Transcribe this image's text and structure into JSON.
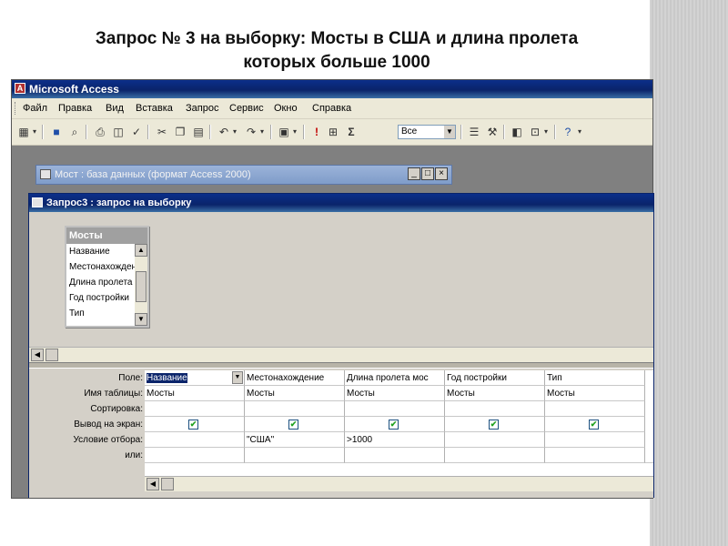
{
  "slide": {
    "title_line1": "Запрос № 3 на выборку: Мосты в США и длина пролета",
    "title_line2": "которых больше 1000"
  },
  "app": {
    "title": "Microsoft Access",
    "menu": [
      "Файл",
      "Правка",
      "Вид",
      "Вставка",
      "Запрос",
      "Сервис",
      "Окно",
      "Справка"
    ],
    "toolbar": {
      "query_type_icon": "Σ",
      "top_values": "Все"
    }
  },
  "db_window": {
    "title": "Мост : база данных (формат Access 2000)",
    "buttons": [
      "_",
      "□",
      "×"
    ]
  },
  "query_window": {
    "title": "Запрос3 : запрос на выборку",
    "field_list": {
      "title": "Мосты",
      "fields": [
        "Название",
        "Местонахождение",
        "Длина пролета",
        "Год постройки",
        "Тип"
      ]
    },
    "row_labels": [
      "Поле:",
      "Имя таблицы:",
      "Сортировка:",
      "Вывод на экран:",
      "Условие отбора:",
      "или:"
    ],
    "columns": [
      {
        "field": "Название",
        "table": "Мосты",
        "sort": "",
        "show": true,
        "criteria": "",
        "or": ""
      },
      {
        "field": "Местонахождение",
        "table": "Мосты",
        "sort": "",
        "show": true,
        "criteria": "\"США\"",
        "or": ""
      },
      {
        "field": "Длина пролета мос",
        "table": "Мосты",
        "sort": "",
        "show": true,
        "criteria": ">1000",
        "or": ""
      },
      {
        "field": "Год постройки",
        "table": "Мосты",
        "sort": "",
        "show": true,
        "criteria": "",
        "or": ""
      },
      {
        "field": "Тип",
        "table": "Мосты",
        "sort": "",
        "show": true,
        "criteria": "",
        "or": ""
      }
    ]
  },
  "colors": {
    "titlebar": "#0a246a",
    "window_face": "#d4d0c8",
    "desktop_bg": "#808080",
    "check": "#21a121"
  }
}
